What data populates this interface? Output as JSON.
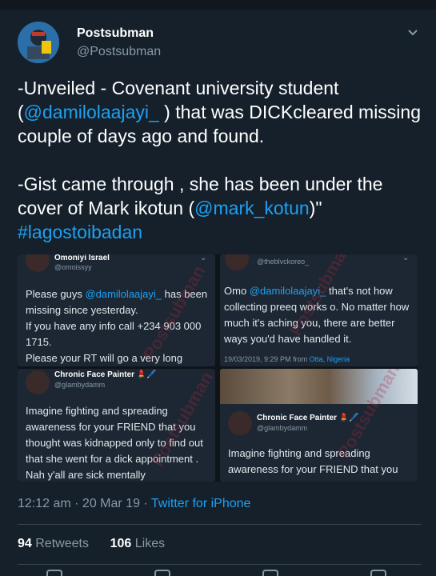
{
  "tweet": {
    "display_name": "Postsubman",
    "handle": "@Postsubman",
    "text_1": "-Unveiled - Covenant university student (",
    "mention_1": "@damilolaajayi_",
    "text_2": " ) that was DICKcleared missing couple of days ago and found.\n\n-Gist came through , she has been under the cover of Mark ikotun (",
    "mention_2": "@mark_kotun",
    "text_3": ")\"",
    "hashtag": "#lagostoibadan",
    "time": "12:12 am · 20 Mar 19 · ",
    "source": "Twitter for iPhone",
    "retweets_count": "94",
    "retweets_label": "Retweets",
    "likes_count": "106",
    "likes_label": "Likes"
  },
  "embedded": {
    "c1": {
      "name": "Omoniyi Israel",
      "handle": "@omoissyy",
      "text_a": "Please guys ",
      "mention": "@damilolaajayi_",
      "text_b": " has been missing since yesterday.\nIf you have any info call +234 903 000 1715.\nPlease your RT will go a very long"
    },
    "c2": {
      "handle": "@theblvckoreo_",
      "text_a": "Omo ",
      "mention": "@damilolaajayi_",
      "text_b": " that's not how collecting preeq works o. No matter how much it's aching you, there are better ways you'd have handled it.",
      "meta": "19/03/2019, 9:29 PM from ",
      "location": "Otta, Nigeria"
    },
    "c3": {
      "name": "Chronic Face Painter 💄🖊️",
      "handle": "@glambydamm",
      "text": "Imagine fighting and spreading awareness for your FRIEND that you thought was kidnapped only to find out that she went for a dick appointment .\nNah y'all are sick mentally"
    },
    "c4": {
      "name": "Chronic Face Painter 💄🖊️",
      "handle": "@glambydamm",
      "text": "Imagine fighting and spreading awareness for your FRIEND that you"
    },
    "watermark": "Postsubman"
  },
  "colors": {
    "background": "#15202b",
    "accent": "#1da1f2",
    "muted": "#8899a6"
  },
  "icons": [
    "avatar-icon",
    "chevron-down-icon",
    "reply-icon",
    "retweet-icon",
    "like-icon",
    "share-icon"
  ]
}
